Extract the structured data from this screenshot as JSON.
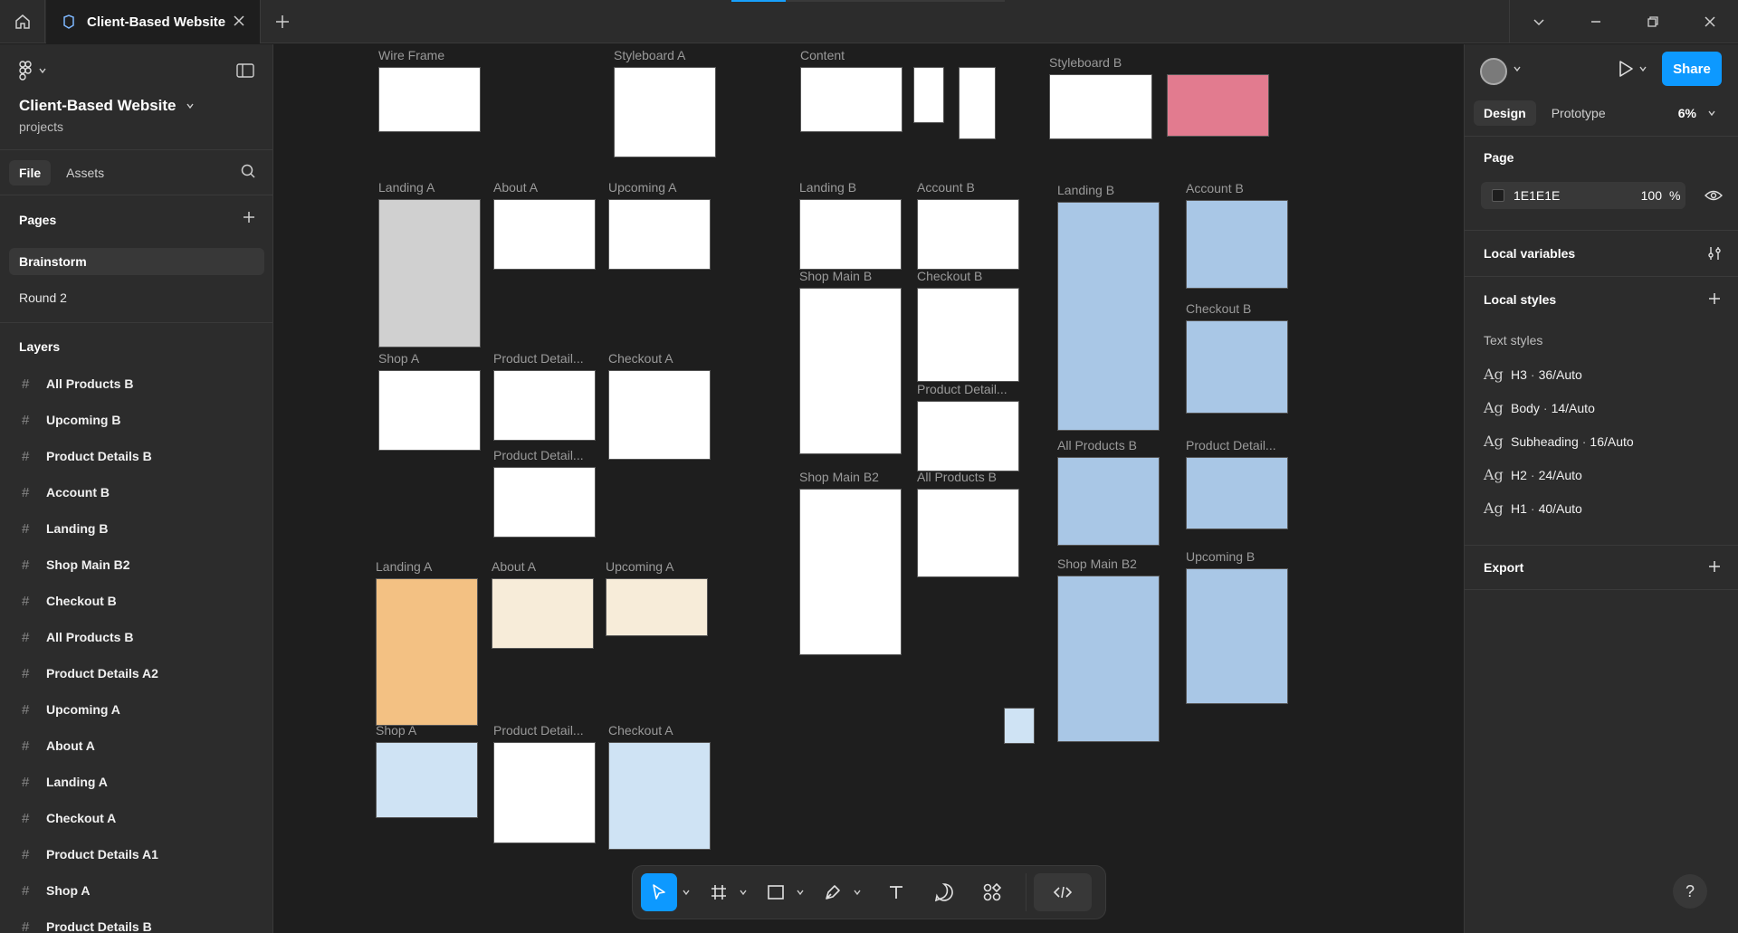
{
  "tab": {
    "title": "Client-Based Website",
    "icon": "figma-file-icon"
  },
  "file": {
    "name": "Client-Based Website",
    "project": "projects"
  },
  "left_tabs": [
    "File",
    "Assets"
  ],
  "pages": {
    "title": "Pages",
    "items": [
      "Brainstorm",
      "Round 2"
    ]
  },
  "layers": {
    "title": "Layers",
    "items": [
      "All Products B",
      "Upcoming B",
      "Product Details B",
      "Account B",
      "Landing B",
      "Shop Main B2",
      "Checkout B",
      "All Products B",
      "Product Details A2",
      "Upcoming A",
      "About A",
      "Landing A",
      "Checkout A",
      "Product Details A1",
      "Shop A",
      "Product Details B"
    ]
  },
  "canvas_labels": {
    "wireframe": "Wire Frame",
    "styleboard_a": "Styleboard A",
    "content": "Content",
    "styleboard_b": "Styleboard B",
    "landing_a": "Landing A",
    "about_a": "About A",
    "upcoming_a": "Upcoming  A",
    "landing_b_gray": "Landing B",
    "account_b_gray": "Account B",
    "landing_b": "Landing B",
    "account_b": "Account B",
    "shop_a": "Shop A",
    "product_detail_a": "Product Detail...",
    "checkout_a": "Checkout A",
    "product_detail_a2": "Product Detail...",
    "shop_main_b": "Shop Main B",
    "checkout_b_gray": "Checkout B",
    "product_detail_b_gray": "Product Detail...",
    "checkout_b": "Checkout B",
    "all_products_b": "All Products B",
    "product_detail_b": "Product Detail...",
    "shop_main_b2_gray": "Shop Main B2",
    "all_products_b_gray": "All Products B",
    "shop_main_b2": "Shop Main B2",
    "upcoming_b": "Upcoming B",
    "landing_a2": "Landing A",
    "about_a2": "About A",
    "upcoming_a2": "Upcoming  A",
    "shop_a2": "Shop A",
    "product_detail_a3": "Product Detail...",
    "checkout_a2": "Checkout A"
  },
  "toolbar": {
    "tools": [
      "move-tool",
      "frame-tool",
      "rectangle-tool",
      "pen-tool",
      "text-tool",
      "comment-tool",
      "actions-tool",
      "dev-mode-toggle"
    ]
  },
  "right": {
    "share": "Share",
    "tabs": [
      "Design",
      "Prototype"
    ],
    "zoom": "6%",
    "page": {
      "title": "Page",
      "color_hex": "1E1E1E",
      "opacity": "100",
      "pct": "%"
    },
    "local_variables": "Local variables",
    "local_styles": "Local styles",
    "text_styles_title": "Text styles",
    "text_styles": [
      {
        "name": "H3",
        "spec": "36/Auto"
      },
      {
        "name": "Body",
        "spec": "14/Auto"
      },
      {
        "name": "Subheading",
        "spec": "16/Auto"
      },
      {
        "name": "H2",
        "spec": "24/Auto"
      },
      {
        "name": "H1",
        "spec": "40/Auto"
      }
    ],
    "ag": "Ag",
    "export": "Export",
    "help": "?"
  },
  "colors": {
    "accent": "#0d99ff",
    "panel": "#2c2c2c",
    "canvas": "#1e1e1e"
  }
}
